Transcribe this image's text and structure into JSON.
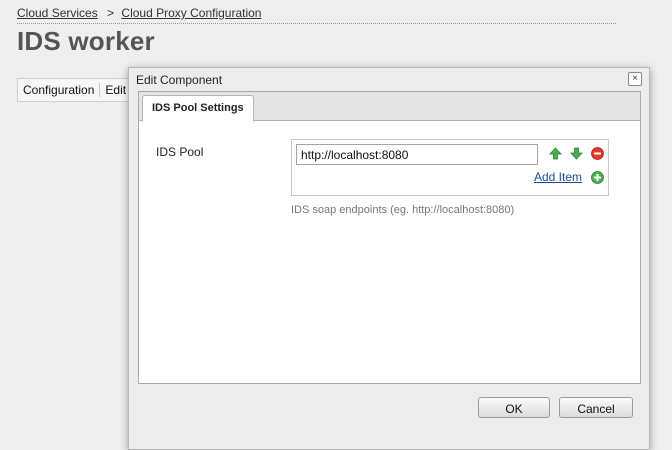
{
  "breadcrumb": {
    "items": [
      "Cloud Services",
      "Cloud Proxy Configuration"
    ],
    "separator": ">"
  },
  "page": {
    "title": "IDS worker"
  },
  "toolbar": {
    "items": [
      "Configuration",
      "Edit"
    ]
  },
  "dialog": {
    "title": "Edit Component",
    "close_glyph": "×",
    "tab_label": "IDS Pool Settings",
    "field_label": "IDS Pool",
    "input_value": "http://localhost:8080",
    "add_item_label": "Add Item",
    "help_text": "IDS soap endpoints (eg. http://localhost:8080)",
    "ok_label": "OK",
    "cancel_label": "Cancel",
    "icons": {
      "move_up": "up-arrow-icon",
      "move_down": "down-arrow-icon",
      "remove": "remove-icon",
      "add": "add-icon"
    }
  },
  "colors": {
    "link": "#1a4d99",
    "icon_green": "#4caf50",
    "icon_red": "#e03a2f",
    "background": "#efefef"
  }
}
